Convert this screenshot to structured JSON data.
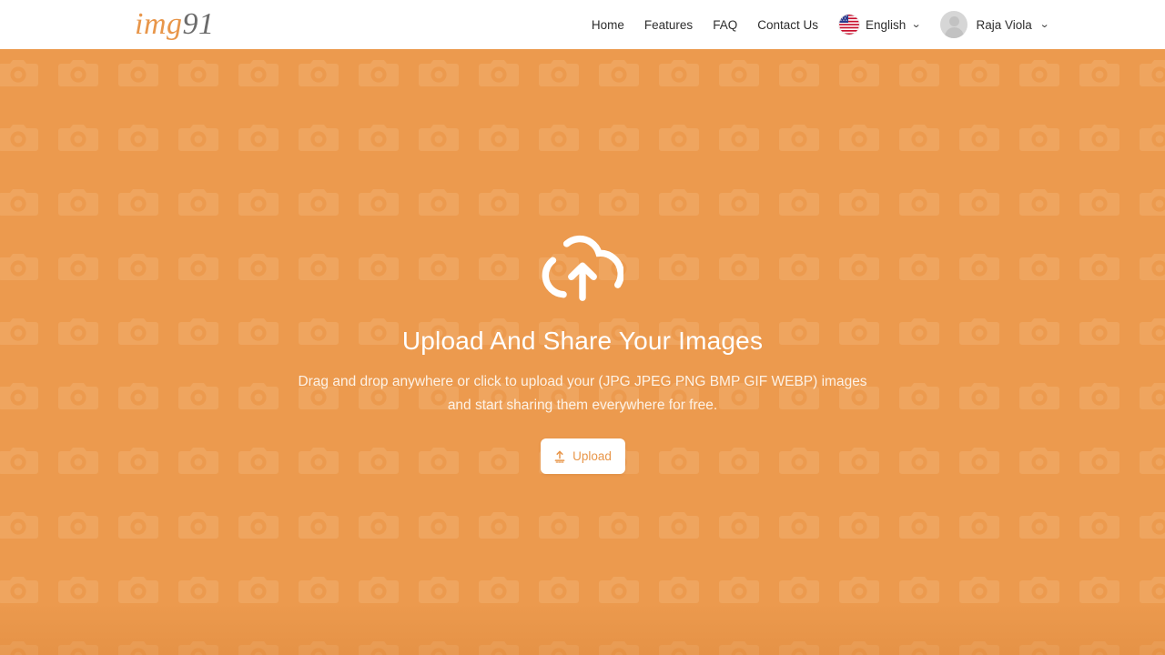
{
  "header": {
    "logo": {
      "part1": "img",
      "part2": "91"
    },
    "nav_items": [
      {
        "label": "Home",
        "name": "nav-home"
      },
      {
        "label": "Features",
        "name": "nav-features"
      },
      {
        "label": "FAQ",
        "name": "nav-faq"
      },
      {
        "label": "Contact Us",
        "name": "nav-contact-us"
      }
    ],
    "language": {
      "label": "English",
      "flag": "us-flag-icon",
      "chevron": "⌄"
    },
    "user": {
      "name": "Raja Viola",
      "avatar": "avatar-placeholder-icon",
      "chevron": "⌄"
    }
  },
  "hero": {
    "icon": "cloud-upload-icon",
    "title": "Upload And Share Your Images",
    "subtitle_line1": "Drag and drop anywhere or click to upload your (JPG JPEG PNG BMP GIF WEBP)",
    "subtitle_line2": "images and start sharing them everywhere for free.",
    "upload_button": {
      "label": "Upload",
      "icon": "upload-arrow-icon"
    },
    "background_pattern": "camera-icon-tile"
  },
  "colors": {
    "brand_orange": "#E8964A",
    "hero_background": "#EC9A4E",
    "hero_pattern": "#EFA55F",
    "header_background": "#FFFFFF",
    "nav_text": "#2E2E2E",
    "hero_title": "#FFFFFF",
    "hero_subtitle": "#FDF2E6",
    "logo_number": "#6B6B6B"
  }
}
